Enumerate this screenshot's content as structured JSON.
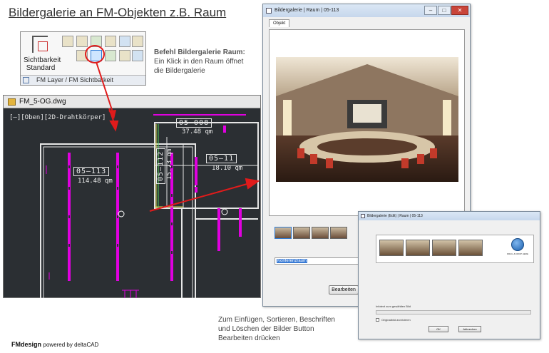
{
  "slide": {
    "title": "Bildergalerie an FM-Objekten z.B. Raum"
  },
  "ribbon": {
    "visibility_label_line1": "Sichtbarkeit",
    "visibility_label_line2": "Standard",
    "footer_label": "FM Layer / FM Sichtbarkeit",
    "highlight_color": "#e01b1b"
  },
  "cad": {
    "tab_label": "FM_5-OG.dwg",
    "view_label": "[–][Oben][2D-Drahtkörper]",
    "rooms": [
      {
        "number": "05–113",
        "area": "114.48 qm"
      },
      {
        "number": "05–008",
        "area": "37.48 qm"
      },
      {
        "number": "05–112",
        "area": "15.73 qm"
      },
      {
        "number": "05–11",
        "area": "18.10 qm"
      }
    ],
    "background": "#2b2f33",
    "accent": "#e000e0"
  },
  "befehl": {
    "heading": "Befehl Bildergalerie Raum:",
    "line1": "Ein Klick in den Raum öffnet",
    "line2": "die Bildergalerie"
  },
  "gallery_window": {
    "title": "Bildergalerie  | Raum | 05-113",
    "tab_label": "Objekt",
    "caption_value": "Konferenzraum",
    "edit_button": "Bearbeiten",
    "minimize_icon": "minimize-icon",
    "maximize_icon": "maximize-icon",
    "close_icon": "close-icon"
  },
  "edit_window": {
    "title": "Bildergalerie (Edit) | Raum | 05-113",
    "edit_icon_label": "DRAG & DROP HERE",
    "field_label": "Infotext zum gewählten Bild",
    "checkbox_label": "Originalbild archivieren",
    "ok_button": "OK",
    "cancel_button": "Abbrechen"
  },
  "bottom_note": {
    "line1": "Zum Einfügen, Sortieren, Beschriften",
    "line2": "und Löschen der Bilder Button",
    "line3": "Bearbeiten drücken"
  },
  "brand": {
    "name": "FMdesign",
    "powered": "powered by deltaCAD"
  }
}
